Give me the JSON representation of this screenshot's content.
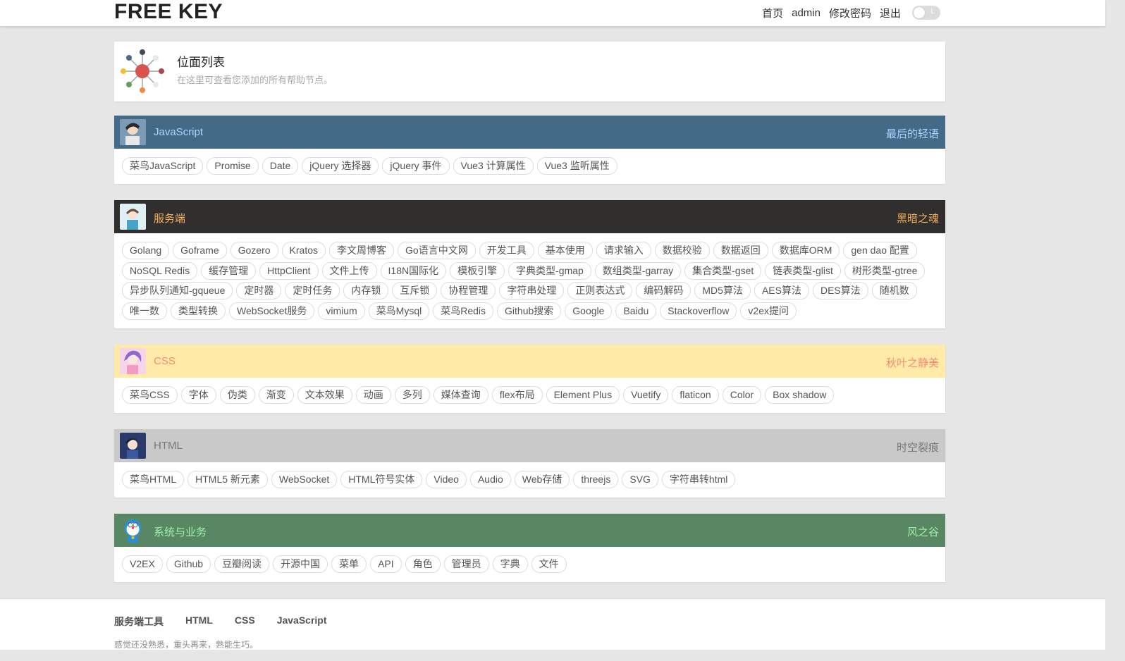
{
  "header": {
    "brand": "FREE KEY",
    "nav": [
      "首页",
      "admin",
      "修改密码",
      "退出"
    ],
    "toggle_label": "L"
  },
  "intro": {
    "title": "位面列表",
    "subtitle": "在这里可查看您添加的所有帮助节点。"
  },
  "sections": [
    {
      "name": "JavaScript",
      "motto": "最后的轻语",
      "head_bg": "#436b88",
      "name_color": "#a9d6ff",
      "motto_color": "#a9d6ff",
      "tags": [
        "菜鸟JavaScript",
        "Promise",
        "Date",
        "jQuery 选择器",
        "jQuery 事件",
        "Vue3 计算属性",
        "Vue3 监听属性"
      ]
    },
    {
      "name": "服务端",
      "motto": "黑暗之魂",
      "head_bg": "#312e2e",
      "name_color": "#f2b25e",
      "motto_color": "#f2b25e",
      "tags": [
        "Golang",
        "Goframe",
        "Gozero",
        "Kratos",
        "李文周博客",
        "Go语言中文网",
        "开发工具",
        "基本使用",
        "请求输入",
        "数据校验",
        "数据返回",
        "数据库ORM",
        "gen dao 配置",
        "NoSQL Redis",
        "缓存管理",
        "HttpClient",
        "文件上传",
        "I18N国际化",
        "模板引擎",
        "字典类型-gmap",
        "数组类型-garray",
        "集合类型-gset",
        "链表类型-glist",
        "树形类型-gtree",
        "异步队列通知-gqueue",
        "定时器",
        "定时任务",
        "内存锁",
        "互斥锁",
        "协程管理",
        "字符串处理",
        "正则表达式",
        "编码解码",
        "MD5算法",
        "AES算法",
        "DES算法",
        "随机数",
        "唯一数",
        "类型转换",
        "WebSocket服务",
        "vimium",
        "菜鸟Mysql",
        "菜鸟Redis",
        "Github搜索",
        "Google",
        "Baidu",
        "Stackoverflow",
        "v2ex提问"
      ]
    },
    {
      "name": "CSS",
      "motto": "秋叶之静美",
      "head_bg": "#ffeaa7",
      "name_color": "#f08d77",
      "motto_color": "#f08d77",
      "tags": [
        "菜鸟CSS",
        "字体",
        "伪类",
        "渐变",
        "文本效果",
        "动画",
        "多列",
        "媒体查询",
        "flex布局",
        "Element Plus",
        "Vuetify",
        "flaticon",
        "Color",
        "Box shadow"
      ]
    },
    {
      "name": "HTML",
      "motto": "时空裂痕",
      "head_bg": "#c9c9c9",
      "name_color": "#777777",
      "motto_color": "#777777",
      "tags": [
        "菜鸟HTML",
        "HTML5 新元素",
        "WebSocket",
        "HTML符号实体",
        "Video",
        "Audio",
        "Web存储",
        "threejs",
        "SVG",
        "字符串转html"
      ]
    },
    {
      "name": "系统与业务",
      "motto": "风之谷",
      "head_bg": "#5a8763",
      "name_color": "#9df2a9",
      "motto_color": "#9df2a9",
      "tags": [
        "V2EX",
        "Github",
        "豆瓣阅读",
        "开源中国",
        "菜单",
        "API",
        "角色",
        "管理员",
        "字典",
        "文件"
      ]
    }
  ],
  "footer": {
    "links": [
      "服务端工具",
      "HTML",
      "CSS",
      "JavaScript"
    ],
    "note": "感觉还没熟悉，重头再来，熟能生巧。"
  }
}
